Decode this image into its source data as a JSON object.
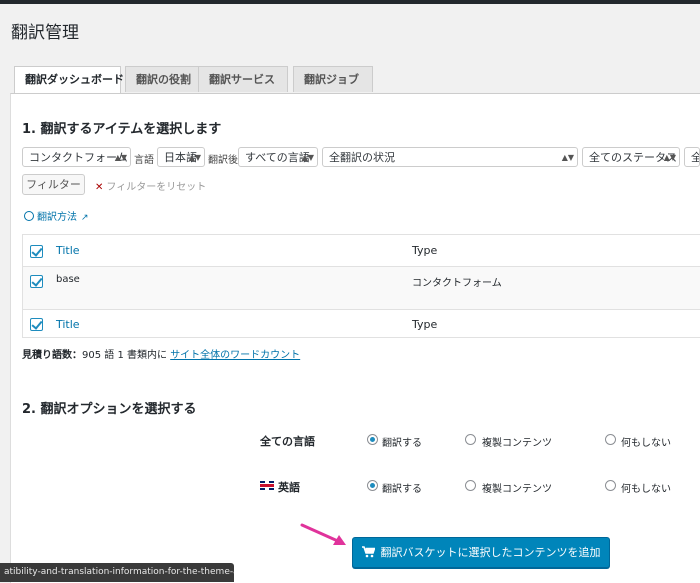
{
  "page": {
    "title": "翻訳管理"
  },
  "tabs": [
    {
      "label": "翻訳ダッシュボード",
      "active": true
    },
    {
      "label": "翻訳の役割"
    },
    {
      "label": "翻訳サービス"
    },
    {
      "label": "翻訳ジョブ"
    }
  ],
  "section1": {
    "heading": "1. 翻訳するアイテムを選択します"
  },
  "filters": {
    "type_select": "コンタクトフォーム",
    "language_label": "言語",
    "language_select": "日本語",
    "translated_to_label": "翻訳後",
    "target_select": "すべての言語",
    "status_select": "全翻訳の状況",
    "state_select": "全てのステータス",
    "extra_select": "全",
    "filter_button": "フィルター",
    "reset_label": "フィルターをリセット"
  },
  "howto": {
    "label": "翻訳方法"
  },
  "table": {
    "head": {
      "title": "Title",
      "type": "Type"
    },
    "rows": [
      {
        "title": "base",
        "type": "コンタクトフォーム"
      }
    ],
    "foot": {
      "title": "Title",
      "type": "Type"
    }
  },
  "estimate": {
    "label": "見積り語数：",
    "text": "905 語 1 書類内に",
    "link": "サイト全体のワードカウント"
  },
  "section2": {
    "heading": "2. 翻訳オプションを選択する"
  },
  "options": {
    "all_languages": "全ての言語",
    "english": "英語",
    "translate": "翻訳する",
    "duplicate": "複製コンテンツ",
    "nothing": "何もしない"
  },
  "cta": {
    "label": "翻訳バスケットに選択したコンテンツを追加"
  },
  "statusbar": {
    "url": "atibility-and-translation-information-for-the-theme-an..."
  },
  "colors": {
    "accent": "#0073aa",
    "button": "#0085ba",
    "arrow": "#e0339b"
  }
}
